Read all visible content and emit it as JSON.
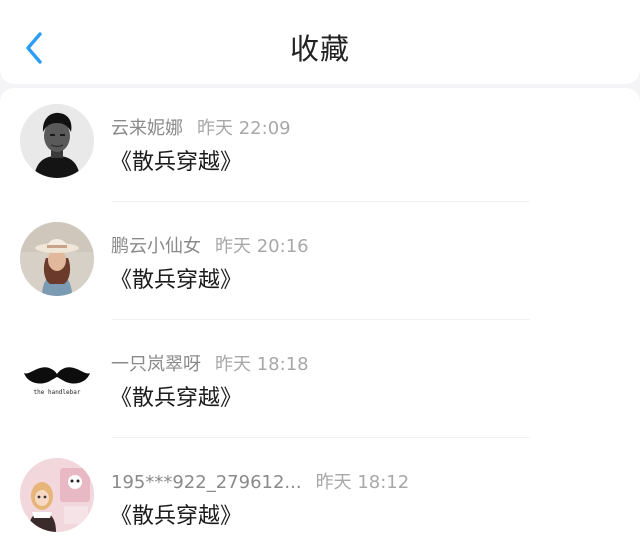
{
  "header": {
    "title": "收藏",
    "back_icon": "chevron-left-icon",
    "accent_color": "#2a9df4"
  },
  "favorites": [
    {
      "user": "云来妮娜",
      "time": "昨天 22:09",
      "title": "《散兵穿越》",
      "avatar": "man-portrait"
    },
    {
      "user": "鹏云小仙女",
      "time": "昨天 20:16",
      "title": "《散兵穿越》",
      "avatar": "girl-with-hat"
    },
    {
      "user": "一只岚翠呀",
      "time": "昨天 18:18",
      "title": "《散兵穿越》",
      "avatar": "mustache-logo",
      "avatar_caption": "the handlebar"
    },
    {
      "user": "195***922_279612...",
      "time": "昨天 18:12",
      "title": "《散兵穿越》",
      "avatar": "doll-pink"
    }
  ]
}
